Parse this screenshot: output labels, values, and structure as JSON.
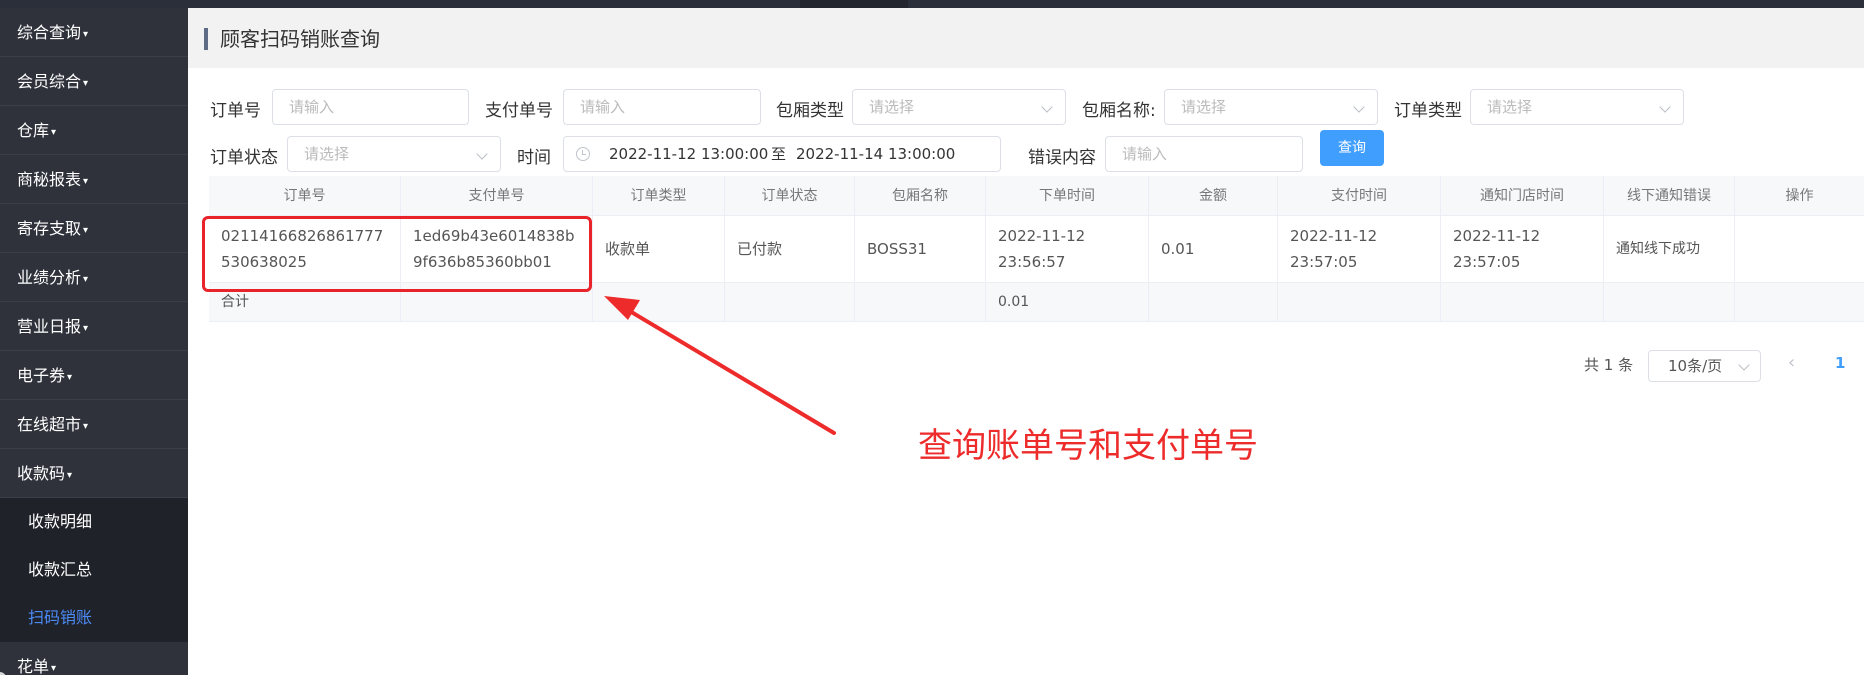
{
  "sidebar": {
    "menu": [
      {
        "label": "综合查询"
      },
      {
        "label": "会员综合"
      },
      {
        "label": "仓库"
      },
      {
        "label": "商秘报表"
      },
      {
        "label": "寄存支取"
      },
      {
        "label": "业绩分析"
      },
      {
        "label": "营业日报"
      },
      {
        "label": "电子券"
      },
      {
        "label": "在线超市"
      },
      {
        "label": "收款码"
      }
    ],
    "submenu": [
      {
        "label": "收款明细"
      },
      {
        "label": "收款汇总"
      },
      {
        "label": "扫码销账",
        "active": true
      }
    ],
    "partial_item": "花单",
    "caret": "▾"
  },
  "page": {
    "title": "顾客扫码销账查询"
  },
  "filters": {
    "order_no": {
      "label": "订单号",
      "placeholder": "请输入"
    },
    "pay_no": {
      "label": "支付单号",
      "placeholder": "请输入"
    },
    "room_type": {
      "label": "包厢类型",
      "placeholder": "请选择"
    },
    "room_name": {
      "label": "包厢名称:",
      "placeholder": "请选择"
    },
    "order_type": {
      "label": "订单类型",
      "placeholder": "请选择"
    },
    "order_status": {
      "label": "订单状态",
      "placeholder": "请选择"
    },
    "time": {
      "label": "时间",
      "start": "2022-11-12 13:00:00",
      "separator": "至",
      "end": "2022-11-14 13:00:00"
    },
    "error": {
      "label": "错误内容",
      "placeholder": "请输入"
    },
    "query_button": "查询"
  },
  "table": {
    "headers": [
      "订单号",
      "支付单号",
      "订单类型",
      "订单状态",
      "包厢名称",
      "下单时间",
      "金额",
      "支付时间",
      "通知门店时间",
      "线下通知错误",
      "操作"
    ],
    "rows": [
      {
        "order_no": "02114166826861777530638025",
        "pay_no": "1ed69b43e6014838b9f636b85360bb01",
        "order_type": "收款单",
        "order_status": "已付款",
        "room_name": "BOSS31",
        "order_time": "2022-11-12 23:56:57",
        "amount": "0.01",
        "pay_time": "2022-11-12 23:57:05",
        "notify_time": "2022-11-12 23:57:05",
        "notify_error": "通知线下成功",
        "action": ""
      }
    ],
    "summary": {
      "label": "合计",
      "amount": "0.01"
    }
  },
  "pagination": {
    "total": "共 1 条",
    "page_size": "10条/页",
    "prev": "‹",
    "current_page": "1"
  },
  "annotation": {
    "text": "查询账单号和支付单号",
    "color": "#ee2b2b"
  },
  "colors": {
    "sidebar_bg": "#2f323b",
    "primary": "#409eff",
    "active_menu": "#4c8bf5"
  }
}
